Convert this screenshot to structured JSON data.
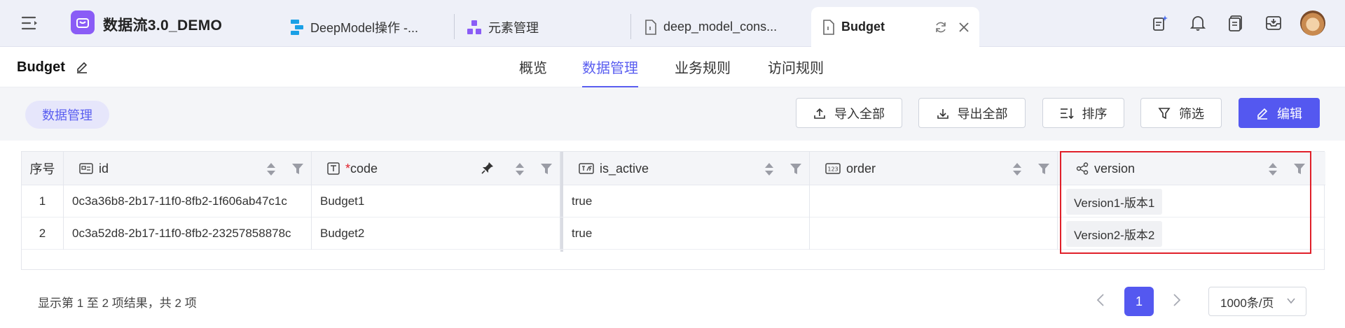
{
  "app": {
    "name": "数据流3.0_DEMO"
  },
  "tabs": [
    {
      "label": "DeepModel操作 -..."
    },
    {
      "label": "元素管理"
    },
    {
      "label": "deep_model_cons..."
    },
    {
      "label": "Budget"
    }
  ],
  "page": {
    "title": "Budget"
  },
  "nav": [
    {
      "label": "概览"
    },
    {
      "label": "数据管理"
    },
    {
      "label": "业务规则"
    },
    {
      "label": "访问规则"
    }
  ],
  "toolbar": {
    "chip": "数据管理",
    "import_all": "导入全部",
    "export_all": "导出全部",
    "sort": "排序",
    "filter": "筛选",
    "edit": "编辑"
  },
  "table": {
    "headers": {
      "index": "序号",
      "id": "id",
      "code_required": "*",
      "code": "code",
      "is_active": "is_active",
      "order": "order",
      "version": "version"
    },
    "rows": [
      {
        "index": "1",
        "id": "0c3a36b8-2b17-11f0-8fb2-1f606ab47c1c",
        "code": "Budget1",
        "is_active": "true",
        "order": "",
        "version": "Version1-版本1"
      },
      {
        "index": "2",
        "id": "0c3a52d8-2b17-11f0-8fb2-23257858878c",
        "code": "Budget2",
        "is_active": "true",
        "order": "",
        "version": "Version2-版本2"
      }
    ]
  },
  "footer": {
    "info": "显示第 1 至 2 项结果，共 2 项",
    "page": "1",
    "page_size": "1000条/页"
  },
  "colors": {
    "accent": "#5458f0",
    "highlight": "#e0202a",
    "logo": "#8a5cf6"
  }
}
